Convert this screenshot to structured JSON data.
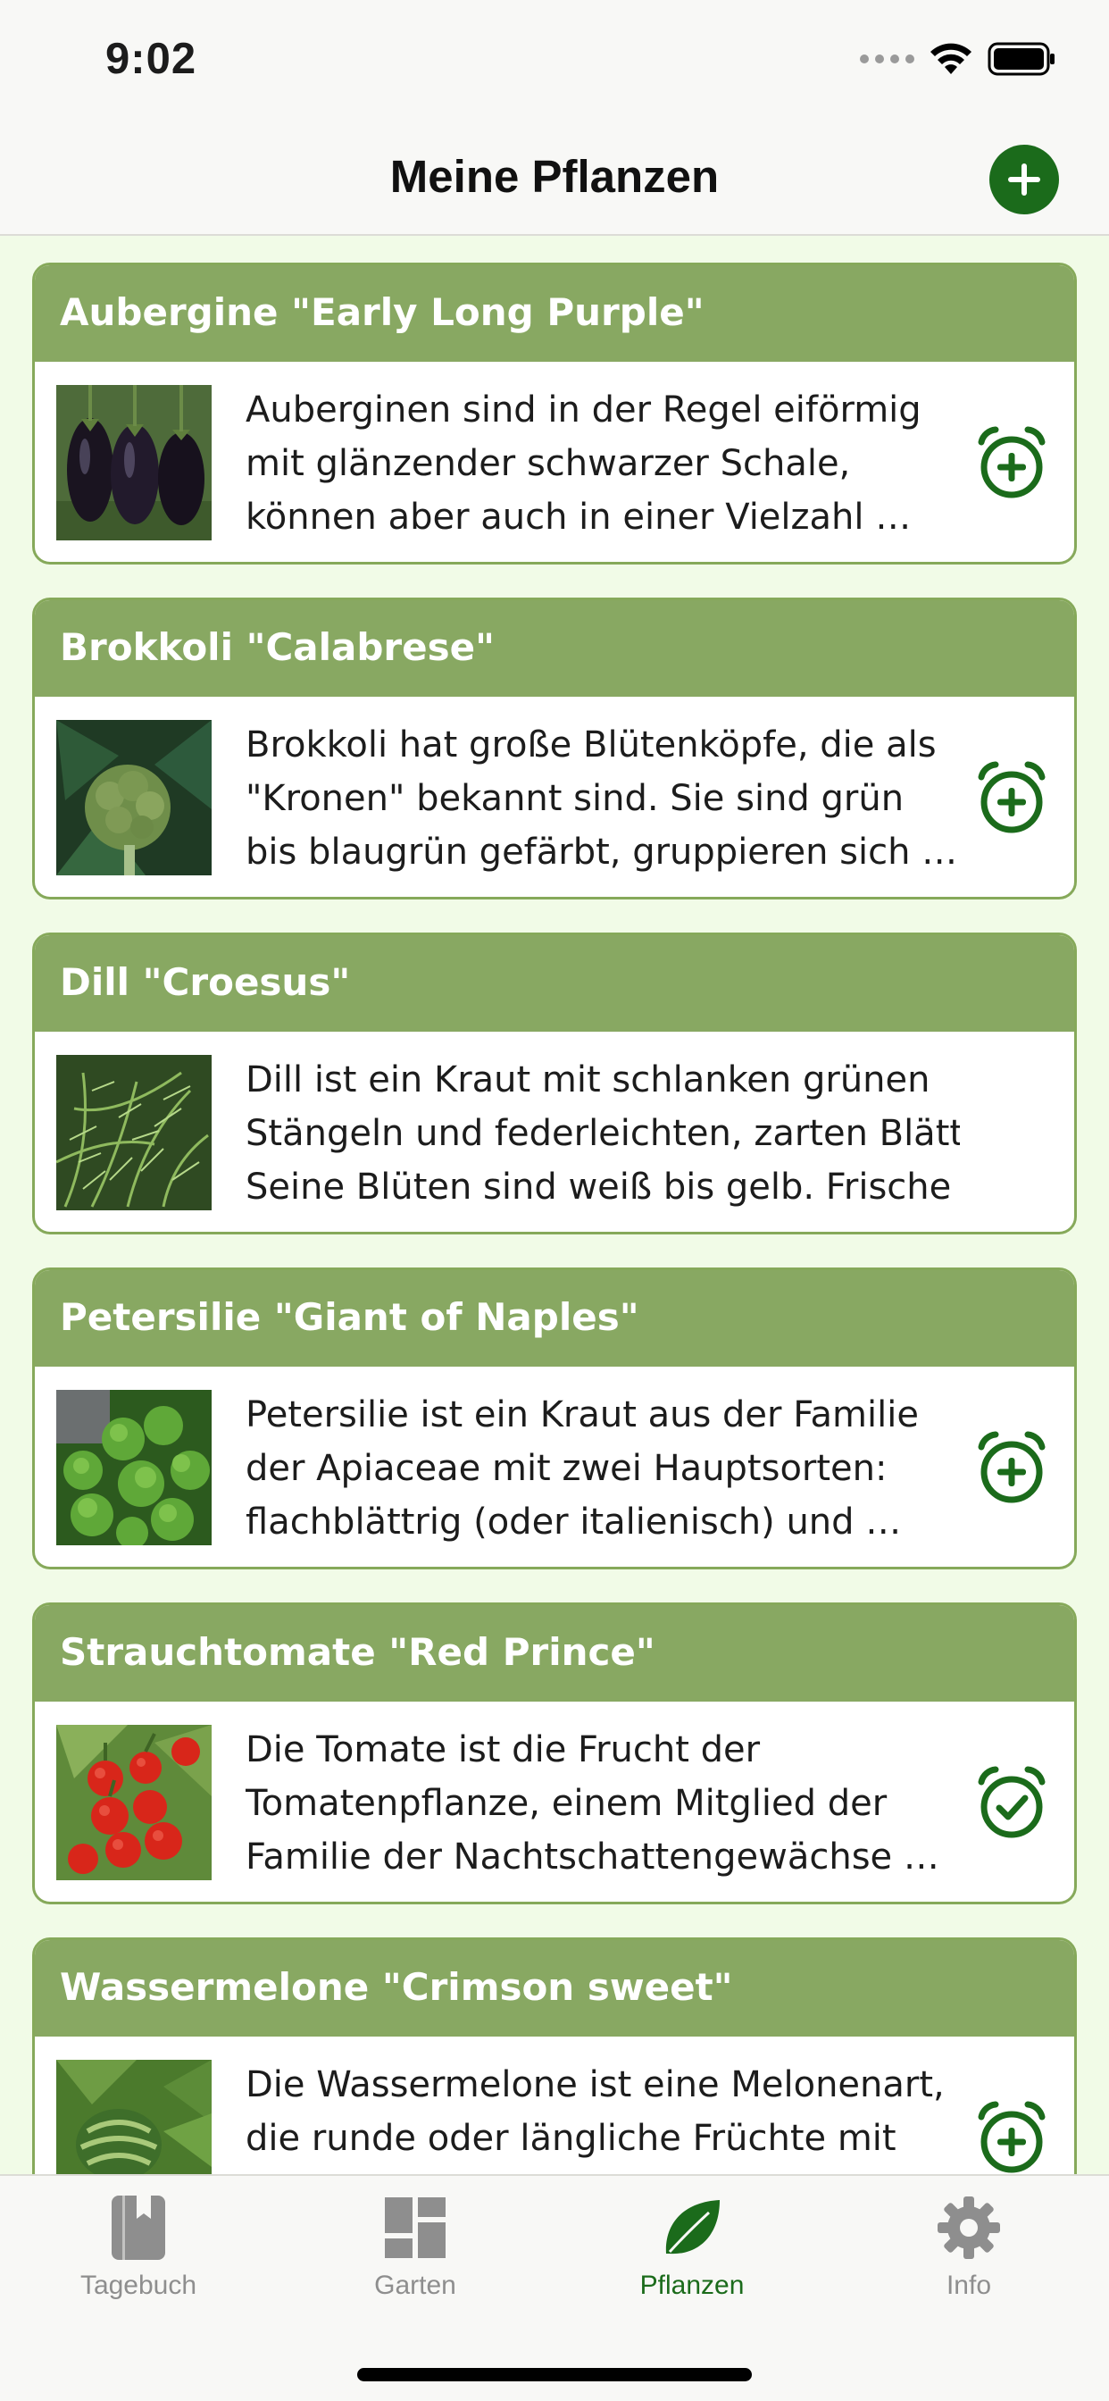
{
  "status_bar": {
    "time": "9:02"
  },
  "nav": {
    "title": "Meine Pflanzen",
    "add_icon": "plus-circle-icon"
  },
  "colors": {
    "accent": "#1b6b1b",
    "card_header": "#88a862",
    "card_border": "#86a95a",
    "background": "#f1fbe7",
    "tab_inactive": "#8e8e8e"
  },
  "plants": [
    {
      "name": "Aubergine \"Early Long Purple\"",
      "image": "eggplant-image",
      "lines": [
        "Auberginen sind in der Regel eiförmig",
        "mit glänzender schwarzer Schale,",
        "können aber auch in einer Vielzahl …"
      ],
      "alarm_icon": "alarm-add-icon"
    },
    {
      "name": "Brokkoli \"Calabrese\"",
      "image": "broccoli-image",
      "lines": [
        "Brokkoli hat große Blütenköpfe, die als",
        "\"Kronen\" bekannt sind. Sie sind grün",
        "bis blaugrün gefärbt, gruppieren sich …"
      ],
      "alarm_icon": "alarm-add-icon"
    },
    {
      "name": "Dill \"Croesus\"",
      "image": "dill-image",
      "lines": [
        "Dill ist ein Kraut mit schlanken grünen",
        "Stängeln und federleichten, zarten Blättern.",
        "Seine Blüten sind weiß bis gelb. Frische un…"
      ],
      "alarm_icon": ""
    },
    {
      "name": "Petersilie \"Giant of Naples\"",
      "image": "parsley-image",
      "lines": [
        "Petersilie ist ein Kraut aus der Familie",
        "der Apiaceae mit zwei Hauptsorten:",
        "flachblättrig (oder italienisch) und …"
      ],
      "alarm_icon": "alarm-add-icon"
    },
    {
      "name": "Strauchtomate \"Red Prince\"",
      "image": "tomato-image",
      "lines": [
        "Die Tomate ist die Frucht der",
        "Tomatenpflanze, einem Mitglied der",
        "Familie der Nachtschattengewächse …"
      ],
      "alarm_icon": "alarm-check-icon"
    },
    {
      "name": "Wassermelone \"Crimson sweet\"",
      "image": "watermelon-image",
      "lines": [
        "Die Wassermelone ist eine Melonenart,",
        "die runde oder längliche Früchte mit",
        ""
      ],
      "alarm_icon": "alarm-add-icon"
    }
  ],
  "tabs": [
    {
      "label": "Tagebuch",
      "icon": "book-icon",
      "active": false
    },
    {
      "label": "Garten",
      "icon": "dashboard-icon",
      "active": false
    },
    {
      "label": "Pflanzen",
      "icon": "leaf-icon",
      "active": true
    },
    {
      "label": "Info",
      "icon": "gear-icon",
      "active": false
    }
  ]
}
